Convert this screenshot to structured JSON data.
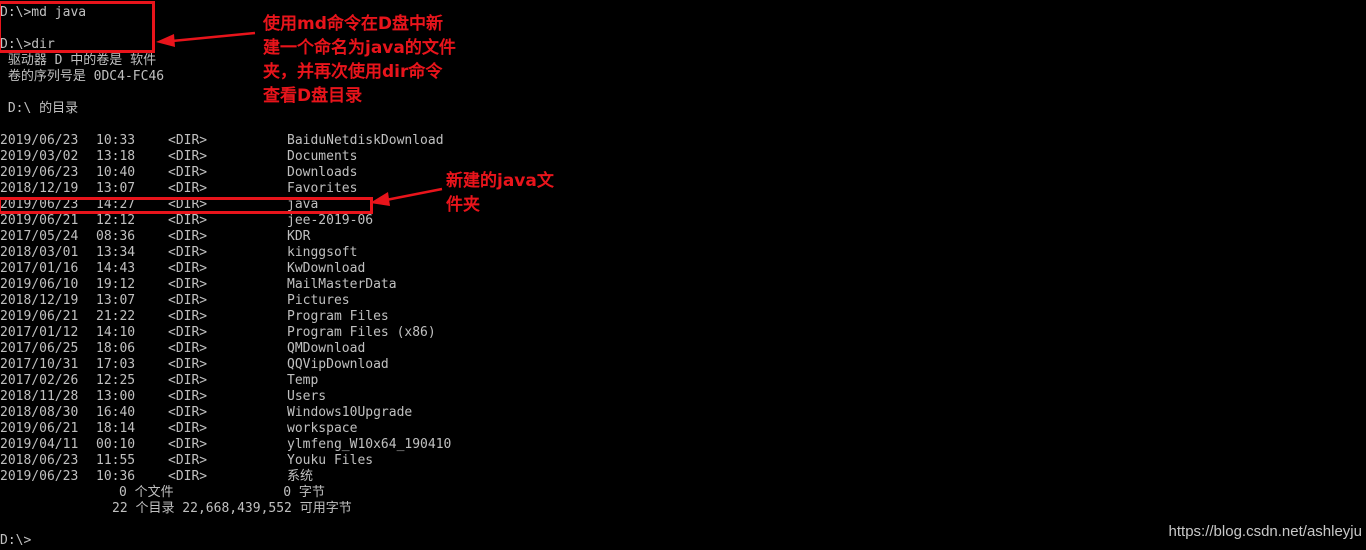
{
  "console": {
    "cmd1": "D:\\>md java",
    "cmd2": "D:\\>dir",
    "volume_line": " 驱动器 D 中的卷是 软件",
    "serial_line": " 卷的序列号是 0DC4-FC46",
    "dir_of": " D:\\ 的目录",
    "entries": [
      {
        "date": "2019/06/23",
        "time": "10:33",
        "type": "<DIR>",
        "name": "BaiduNetdiskDownload"
      },
      {
        "date": "2019/03/02",
        "time": "13:18",
        "type": "<DIR>",
        "name": "Documents"
      },
      {
        "date": "2019/06/23",
        "time": "10:40",
        "type": "<DIR>",
        "name": "Downloads"
      },
      {
        "date": "2018/12/19",
        "time": "13:07",
        "type": "<DIR>",
        "name": "Favorites"
      },
      {
        "date": "2019/06/23",
        "time": "14:27",
        "type": "<DIR>",
        "name": "java"
      },
      {
        "date": "2019/06/21",
        "time": "12:12",
        "type": "<DIR>",
        "name": "jee-2019-06"
      },
      {
        "date": "2017/05/24",
        "time": "08:36",
        "type": "<DIR>",
        "name": "KDR"
      },
      {
        "date": "2018/03/01",
        "time": "13:34",
        "type": "<DIR>",
        "name": "kinggsoft"
      },
      {
        "date": "2017/01/16",
        "time": "14:43",
        "type": "<DIR>",
        "name": "KwDownload"
      },
      {
        "date": "2019/06/10",
        "time": "19:12",
        "type": "<DIR>",
        "name": "MailMasterData"
      },
      {
        "date": "2018/12/19",
        "time": "13:07",
        "type": "<DIR>",
        "name": "Pictures"
      },
      {
        "date": "2019/06/21",
        "time": "21:22",
        "type": "<DIR>",
        "name": "Program Files"
      },
      {
        "date": "2017/01/12",
        "time": "14:10",
        "type": "<DIR>",
        "name": "Program Files (x86)"
      },
      {
        "date": "2017/06/25",
        "time": "18:06",
        "type": "<DIR>",
        "name": "QMDownload"
      },
      {
        "date": "2017/10/31",
        "time": "17:03",
        "type": "<DIR>",
        "name": "QQVipDownload"
      },
      {
        "date": "2017/02/26",
        "time": "12:25",
        "type": "<DIR>",
        "name": "Temp"
      },
      {
        "date": "2018/11/28",
        "time": "13:00",
        "type": "<DIR>",
        "name": "Users"
      },
      {
        "date": "2018/08/30",
        "time": "16:40",
        "type": "<DIR>",
        "name": "Windows10Upgrade"
      },
      {
        "date": "2019/06/21",
        "time": "18:14",
        "type": "<DIR>",
        "name": "workspace"
      },
      {
        "date": "2019/04/11",
        "time": "00:10",
        "type": "<DIR>",
        "name": "ylmfeng_W10x64_190410"
      },
      {
        "date": "2018/06/23",
        "time": "11:55",
        "type": "<DIR>",
        "name": "Youku Files"
      },
      {
        "date": "2019/06/23",
        "time": "10:36",
        "type": "<DIR>",
        "name": "系统"
      }
    ],
    "summary_files": "0 个文件              0 字节",
    "summary_dirs": "22 个目录 22,668,439,552 可用字节",
    "prompt": "D:\\>"
  },
  "annotations": {
    "note1": "使用md命令在D盘中新\n建一个命名为java的文件\n夹，并再次使用dir命令\n查看D盘目录",
    "note2": "新建的java文\n件夹",
    "color": "#e8141b"
  },
  "watermark": "https://blog.csdn.net/ashleyju"
}
